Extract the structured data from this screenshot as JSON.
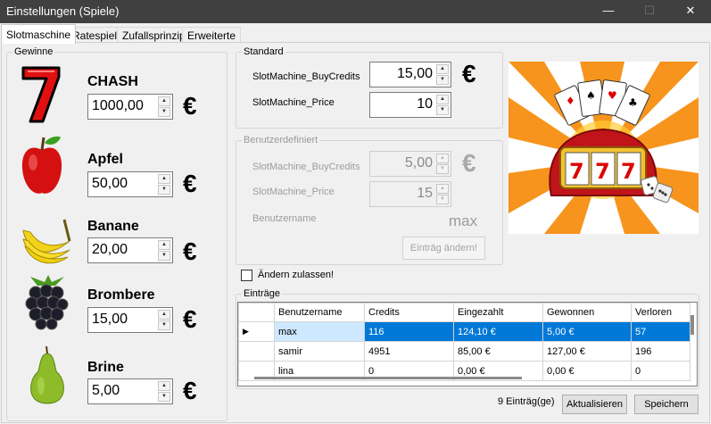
{
  "window": {
    "title": "Einstellungen (Spiele)",
    "controls": {
      "minimize": "—",
      "maximize": "☐",
      "close": "✕"
    }
  },
  "tabs": [
    {
      "label": "Slotmaschine",
      "active": true
    },
    {
      "label": "Ratespiel",
      "active": false
    },
    {
      "label": "Zufallsprinzip",
      "active": false
    },
    {
      "label": "Erweiterte",
      "active": false
    }
  ],
  "gewinne": {
    "legend": "Gewinne",
    "items": [
      {
        "name": "CHASH",
        "value": "1000,00",
        "currency": "€",
        "icon": "seven-icon"
      },
      {
        "name": "Apfel",
        "value": "50,00",
        "currency": "€",
        "icon": "apple-icon"
      },
      {
        "name": "Banane",
        "value": "20,00",
        "currency": "€",
        "icon": "banana-icon"
      },
      {
        "name": "Brombere",
        "value": "15,00",
        "currency": "€",
        "icon": "blackberry-icon"
      },
      {
        "name": "Brine",
        "value": "5,00",
        "currency": "€",
        "icon": "pear-icon"
      }
    ]
  },
  "standard": {
    "legend": "Standard",
    "buy_credits_label": "SlotMachine_BuyCredits",
    "buy_credits_value": "15,00",
    "price_label": "SlotMachine_Price",
    "price_value": "10",
    "currency": "€"
  },
  "benutzerdefiniert": {
    "legend": "Benutzerdefiniert",
    "buy_credits_label": "SlotMachine_BuyCredits",
    "buy_credits_value": "5,00",
    "price_label": "SlotMachine_Price",
    "price_value": "15",
    "username_label": "Benutzername",
    "username_value": "max",
    "currency": "€",
    "change_button": "Einträg ändern!"
  },
  "allow_changes": {
    "label": "Ändern zulassen!",
    "checked": false
  },
  "eintraege": {
    "legend": "Einträge",
    "columns": [
      "Benutzername",
      "Credits",
      "Eingezahlt",
      "Gewonnen",
      "Verloren"
    ],
    "rows": [
      {
        "selected": true,
        "cells": [
          "max",
          "116",
          "124,10 €",
          "5,00 €",
          "57"
        ]
      },
      {
        "selected": false,
        "cells": [
          "samir",
          "4951",
          "85,00 €",
          "127,00 €",
          "196"
        ]
      },
      {
        "selected": false,
        "cells": [
          "lina",
          "0",
          "0,00 €",
          "0,00 €",
          "0"
        ]
      }
    ],
    "selected_marker": "▶"
  },
  "footer": {
    "count_text": "9 Einträg(ge)",
    "refresh_button": "Aktualisieren",
    "save_button": "Speichern"
  },
  "colors": {
    "titlebar": "#404040",
    "selection": "#0078d7",
    "disabled_text": "#9c9c9c"
  }
}
